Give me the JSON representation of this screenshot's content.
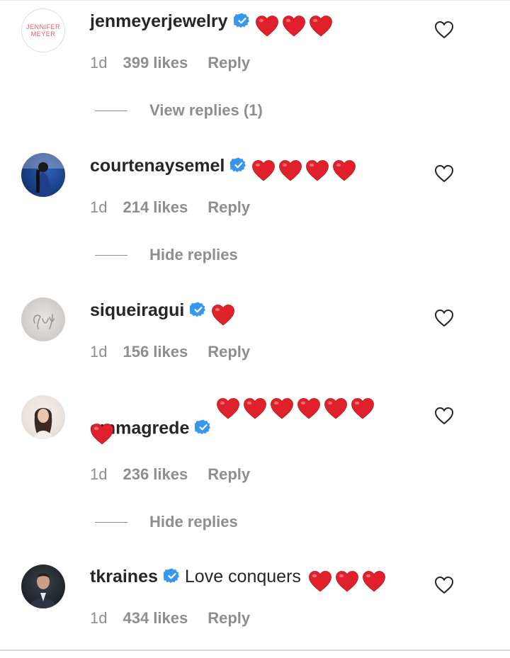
{
  "colors": {
    "heart_red": "#e0212b",
    "verified_blue": "#3797f0",
    "secondary_text": "#8e8e8e",
    "primary_text": "#262626"
  },
  "avatar_logo_text": "JENNIFER MEYER",
  "comments": [
    {
      "username": "jenmeyerjewelry",
      "verified": true,
      "text": "",
      "hearts": 3,
      "time": "1d",
      "likes": "399 likes",
      "reply": "Reply",
      "replies_toggle": "View replies (1)"
    },
    {
      "username": "courtenaysemel",
      "verified": true,
      "text": "",
      "hearts": 4,
      "time": "1d",
      "likes": "214 likes",
      "reply": "Reply",
      "replies_toggle": "Hide replies"
    },
    {
      "username": "siqueiragui",
      "verified": true,
      "text": "",
      "hearts": 1,
      "time": "1d",
      "likes": "156 likes",
      "reply": "Reply"
    },
    {
      "username": "emmagrede",
      "verified": true,
      "text": "",
      "hearts": 7,
      "time": "1d",
      "likes": "236 likes",
      "reply": "Reply",
      "replies_toggle": "Hide replies"
    },
    {
      "username": "tkraines",
      "verified": true,
      "text": "Love conquers",
      "hearts": 3,
      "time": "1d",
      "likes": "434 likes",
      "reply": "Reply"
    }
  ]
}
